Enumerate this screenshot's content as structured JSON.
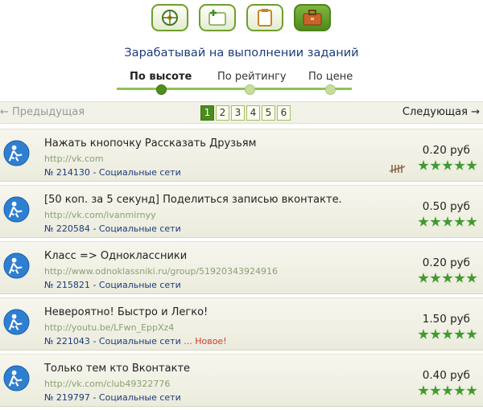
{
  "toolbar": {
    "buttons": [
      {
        "icon": "globe-icon"
      },
      {
        "icon": "add-window-icon"
      },
      {
        "icon": "clipboard-icon"
      },
      {
        "icon": "briefcase-icon",
        "active": true
      }
    ]
  },
  "heading": "Зарабатывай на выполнении заданий",
  "sort_tabs": [
    "По высоте",
    "По рейтингу",
    "По цене"
  ],
  "pager": {
    "prev": "← Предыдущая",
    "next": "Следующая →",
    "pages": [
      "1",
      "2",
      "3",
      "4",
      "5",
      "6"
    ],
    "current": "1"
  },
  "tasks": [
    {
      "title": "Нажать кнопочку Рассказать Друзьям",
      "url": "http://vk.com",
      "number": "№ 214130",
      "category": "Социальные сети",
      "price": "0.20 руб",
      "new_label": "",
      "rating": 5
    },
    {
      "title": "[50 коп. за 5 секунд] Поделиться записью вконтакте.",
      "url": "http://vk.com/ivanmirnyy",
      "number": "№ 220584",
      "category": "Социальные сети",
      "price": "0.50 руб",
      "new_label": "",
      "rating": 5
    },
    {
      "title": "Класс => Одноклассники",
      "url": "http://www.odnoklassniki.ru/group/51920343924916",
      "number": "№ 215821",
      "category": "Социальные сети",
      "price": "0.20 руб",
      "new_label": "",
      "rating": 5
    },
    {
      "title": "Невероятно! Быстро и Легко!",
      "url": "http://youtu.be/LFwn_EppXz4",
      "number": "№ 221043",
      "category": "Социальные сети",
      "price": "1.50 руб",
      "new_label": "... Новое!",
      "rating": 5
    },
    {
      "title": "Только тем кто Вконтакте",
      "url": "http://vk.com/club49322776",
      "number": "№ 219797",
      "category": "Социальные сети",
      "price": "0.40 руб",
      "new_label": "",
      "rating": 5
    }
  ],
  "colors": {
    "accent": "#4b8b1c",
    "link": "#1d3b7a",
    "new": "#d43a2a",
    "star": "#3f9b2c"
  }
}
